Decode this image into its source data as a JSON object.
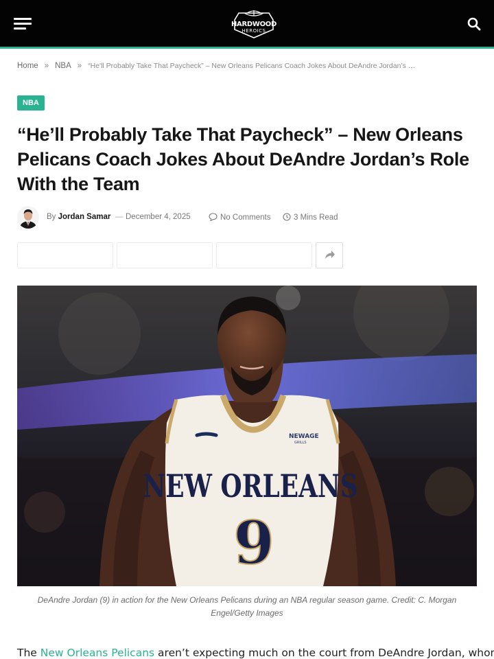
{
  "header": {
    "logo_main": "HARDWOOD",
    "logo_sub": "HEROICS",
    "menu_icon": "hamburger-menu-icon",
    "search_icon": "search-icon",
    "accent_color": "#2ab391",
    "bar_color": "#030303"
  },
  "breadcrumb": {
    "home": "Home",
    "separator": "»",
    "section": "NBA",
    "current": "“He'll Probably Take That Paycheck” – New Orleans Pelicans Coach Jokes About DeAndre Jordan’s …"
  },
  "article": {
    "category": "NBA",
    "title": "“He’ll Probably Take That Paycheck” – New Orleans Pelicans Coach Jokes About DeAndre Jordan’s Role With the Team",
    "meta": {
      "by_label": "By",
      "author": "Jordan Samar",
      "dash": "—",
      "date": "December 4, 2025",
      "comments": "No Comments",
      "read_time": "3 Mins Read"
    },
    "share": {
      "more_icon": "share-arrow-icon"
    },
    "image": {
      "jersey_brand": "NEWAGE",
      "jersey_brand_sub": "GRILLS",
      "jersey_team": "NEW ORLEANS",
      "jersey_number": "9"
    },
    "caption": "DeAndre Jordan (9) in action for the New Orleans Pelicans during an NBA regular season game. Credit: C. Morgan Engel/Getty Images",
    "body": {
      "prefix": "The ",
      "link_text": "New Orleans Pelicans",
      "suffix": " aren’t expecting much on the court from DeAndre Jordan, whom"
    }
  }
}
